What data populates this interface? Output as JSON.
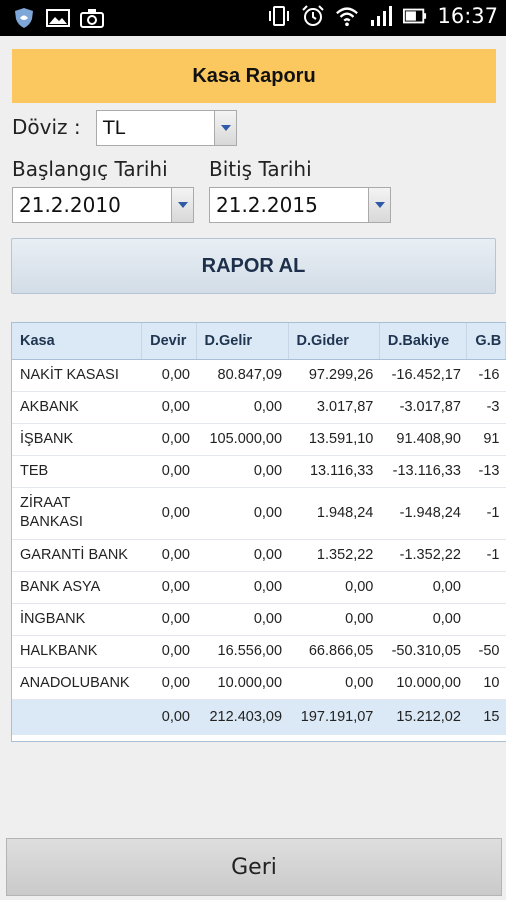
{
  "status_bar": {
    "time": "16:37"
  },
  "title": "Kasa Raporu",
  "currency": {
    "label": "Döviz :",
    "value": "TL"
  },
  "start_date": {
    "label": "Başlangıç Tarihi",
    "value": "21.2.2010"
  },
  "end_date": {
    "label": "Bitiş Tarihi",
    "value": "21.2.2015"
  },
  "report_button": "RAPOR AL",
  "table": {
    "headers": [
      "Kasa",
      "Devir",
      "D.Gelir",
      "D.Gider",
      "D.Bakiye",
      "G.B"
    ],
    "rows": [
      {
        "name": "NAKİT KASASI",
        "devir": "0,00",
        "gelir": "80.847,09",
        "gider": "97.299,26",
        "bakiye": "-16.452,17",
        "gb": "-16"
      },
      {
        "name": "AKBANK",
        "devir": "0,00",
        "gelir": "0,00",
        "gider": "3.017,87",
        "bakiye": "-3.017,87",
        "gb": "-3"
      },
      {
        "name": "İŞBANK",
        "devir": "0,00",
        "gelir": "105.000,00",
        "gider": "13.591,10",
        "bakiye": "91.408,90",
        "gb": "91"
      },
      {
        "name": "TEB",
        "devir": "0,00",
        "gelir": "0,00",
        "gider": "13.116,33",
        "bakiye": "-13.116,33",
        "gb": "-13"
      },
      {
        "name": "ZİRAAT BANKASI",
        "devir": "0,00",
        "gelir": "0,00",
        "gider": "1.948,24",
        "bakiye": "-1.948,24",
        "gb": "-1"
      },
      {
        "name": "GARANTİ BANK",
        "devir": "0,00",
        "gelir": "0,00",
        "gider": "1.352,22",
        "bakiye": "-1.352,22",
        "gb": "-1"
      },
      {
        "name": "BANK ASYA",
        "devir": "0,00",
        "gelir": "0,00",
        "gider": "0,00",
        "bakiye": "0,00",
        "gb": ""
      },
      {
        "name": "İNGBANK",
        "devir": "0,00",
        "gelir": "0,00",
        "gider": "0,00",
        "bakiye": "0,00",
        "gb": ""
      },
      {
        "name": "HALKBANK",
        "devir": "0,00",
        "gelir": "16.556,00",
        "gider": "66.866,05",
        "bakiye": "-50.310,05",
        "gb": "-50"
      },
      {
        "name": "ANADOLUBANK",
        "devir": "0,00",
        "gelir": "10.000,00",
        "gider": "0,00",
        "bakiye": "10.000,00",
        "gb": "10"
      }
    ],
    "totals": {
      "devir": "0,00",
      "gelir": "212.403,09",
      "gider": "197.191,07",
      "bakiye": "15.212,02",
      "gb": "15"
    }
  },
  "back_button": "Geri"
}
